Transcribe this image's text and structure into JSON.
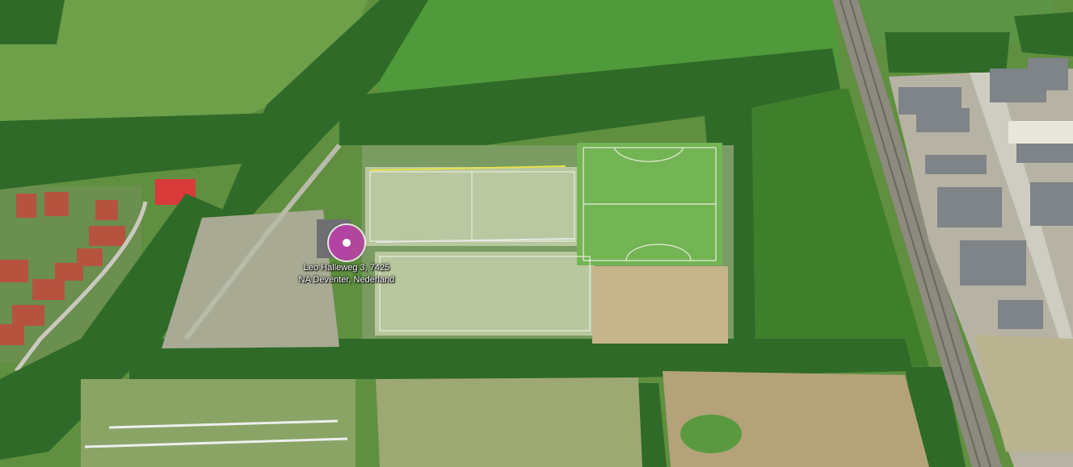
{
  "map": {
    "view": "aerial",
    "location_pin": {
      "icon": "location-pin-icon",
      "color": "#be3caa",
      "address_line1": "Leo Halleweg 3, 7425",
      "address_line2": "NA Deventer, Nederland"
    }
  }
}
